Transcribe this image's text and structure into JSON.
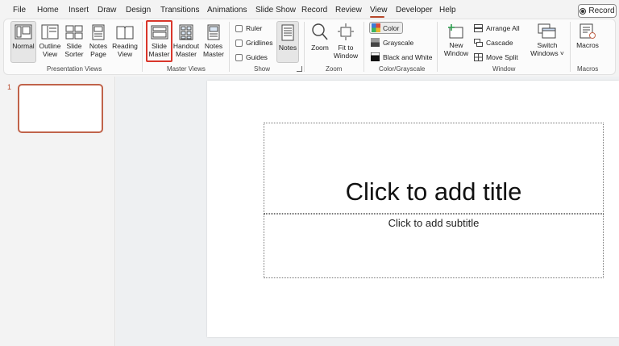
{
  "menu": {
    "tabs": [
      {
        "label": "File"
      },
      {
        "label": "Home"
      },
      {
        "label": "Insert"
      },
      {
        "label": "Draw"
      },
      {
        "label": "Design"
      },
      {
        "label": "Transitions"
      },
      {
        "label": "Animations"
      },
      {
        "label": "Slide Show"
      },
      {
        "label": "Record"
      },
      {
        "label": "Review"
      },
      {
        "label": "View",
        "active": true
      },
      {
        "label": "Developer"
      },
      {
        "label": "Help"
      }
    ],
    "record_button": "Record"
  },
  "ribbon": {
    "presentation_views": {
      "label": "Presentation Views",
      "normal": "Normal",
      "outline": [
        "Outline",
        "View"
      ],
      "sorter": [
        "Slide",
        "Sorter"
      ],
      "notes_page": [
        "Notes",
        "Page"
      ],
      "reading": [
        "Reading",
        "View"
      ]
    },
    "master_views": {
      "label": "Master Views",
      "slide_master": [
        "Slide",
        "Master"
      ],
      "handout_master": [
        "Handout",
        "Master"
      ],
      "notes_master": [
        "Notes",
        "Master"
      ]
    },
    "show": {
      "label": "Show",
      "ruler": "Ruler",
      "gridlines": "Gridlines",
      "guides": "Guides",
      "notes": "Notes"
    },
    "zoom": {
      "label": "Zoom",
      "zoom": "Zoom",
      "fit": [
        "Fit to",
        "Window"
      ]
    },
    "color": {
      "label": "Color/Grayscale",
      "color": "Color",
      "grayscale": "Grayscale",
      "bw": "Black and White"
    },
    "window": {
      "label": "Window",
      "new_window": [
        "New",
        "Window"
      ],
      "arrange_all": "Arrange All",
      "cascade": "Cascade",
      "move_split": "Move Split",
      "switch": [
        "Switch",
        "Windows ˅"
      ]
    },
    "macros": {
      "label": "Macros",
      "macros": "Macros"
    }
  },
  "slides": {
    "thumbnail_number": "1"
  },
  "slide": {
    "title_placeholder": "Click to add title",
    "subtitle_placeholder": "Click to add subtitle"
  },
  "colors": {
    "accent": "#b7472a",
    "highlight": "#d9362b"
  }
}
